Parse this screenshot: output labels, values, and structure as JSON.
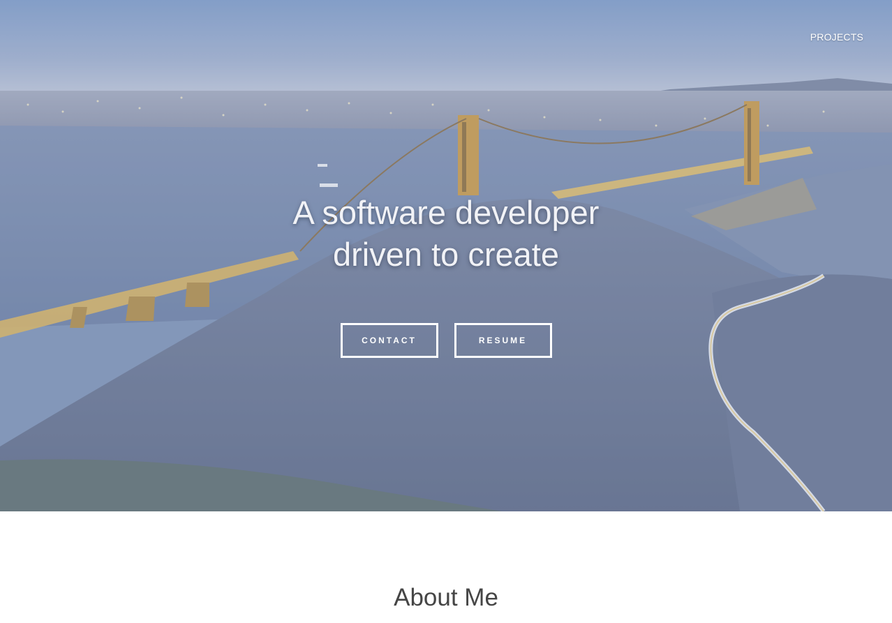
{
  "nav": {
    "projects_label": "PROJECTS"
  },
  "hero": {
    "headline_line1": "A software developer",
    "headline_line2": "driven to create",
    "background_image": "night-cityscape-bridge-hills",
    "contact_label": "CONTACT",
    "resume_label": "RESUME"
  },
  "about": {
    "title": "About Me"
  },
  "colors": {
    "hero_overlay": "#8fa3c4",
    "headline_text": "#f1f2f6",
    "button_border": "#ffffff",
    "about_text": "#454545",
    "page_bg": "#ffffff"
  }
}
